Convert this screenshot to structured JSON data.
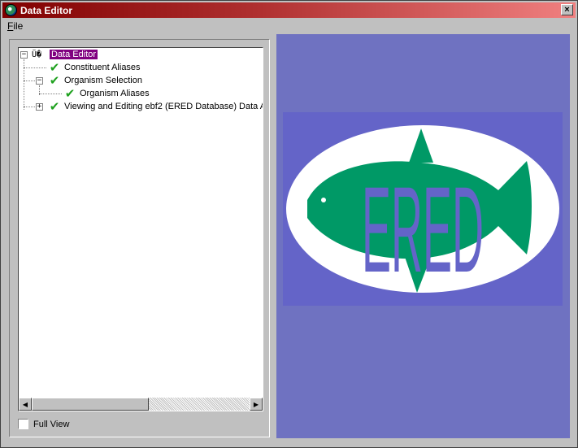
{
  "window": {
    "title": "Data Editor",
    "close_label": "×"
  },
  "menu": {
    "file_label_ul": "F",
    "file_label_rest": "ile"
  },
  "tree": {
    "root": {
      "label": "Data Editor",
      "expander": "−",
      "icon_text": "Ü�"
    },
    "items": [
      {
        "label": "Constituent Aliases"
      },
      {
        "label": "Organism Selection",
        "expander": "−"
      },
      {
        "label": "Organism Aliases"
      },
      {
        "label": "Viewing and Editing ebf2 (ERED Database) Data A",
        "expander": "+"
      }
    ]
  },
  "scrollbar": {
    "left_arrow": "◀",
    "right_arrow": "▶"
  },
  "full_view": {
    "label": "Full View",
    "checked": false
  },
  "logo": {
    "text": "ERED"
  },
  "colors": {
    "titlebar_start": "#800000",
    "titlebar_end": "#f08080",
    "selection": "#800080",
    "check": "#1fa11f",
    "panel_bg": "#6f72c1",
    "logo_bg": "#6464c8",
    "fish": "#009966",
    "oval": "#ffffff"
  }
}
